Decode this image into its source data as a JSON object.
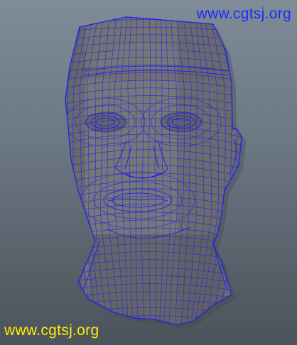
{
  "viewport": {
    "background_top": "#7f8c97",
    "background_bottom": "#4b535b",
    "mesh_fill": "#6e6e6e",
    "wire_color": "#2a2fd8"
  },
  "watermarks": {
    "top_right": "www.cgtsj.org",
    "bottom_left": "www.cgtsj.org",
    "top_right_color": "#1a2cff",
    "bottom_left_color": "#ffee00"
  }
}
